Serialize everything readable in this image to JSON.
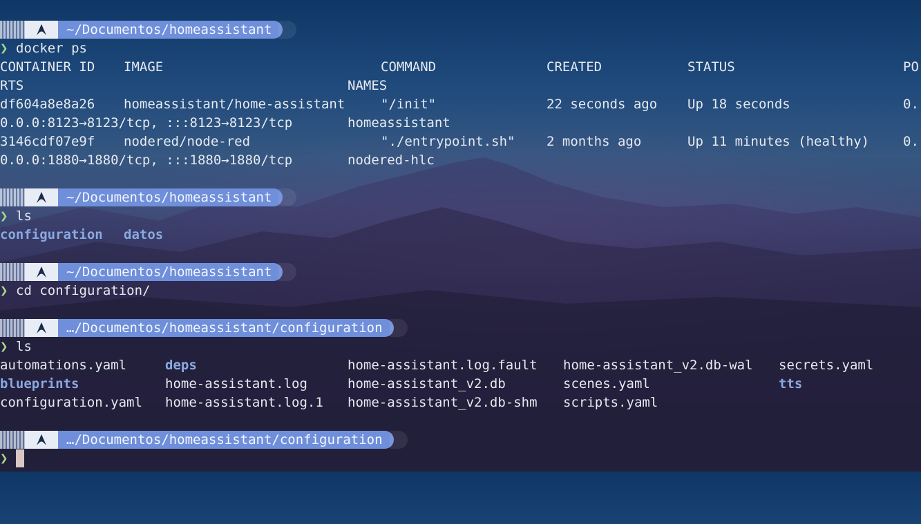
{
  "prompt_symbol": "❯",
  "os_icon": "arch-linux-icon",
  "prompts": [
    {
      "path": "~/Documentos/homeassistant",
      "command": "docker ps"
    },
    {
      "path": "~/Documentos/homeassistant",
      "command": "ls"
    },
    {
      "path": "~/Documentos/homeassistant",
      "command": "cd configuration/"
    },
    {
      "path": "…/Documentos/homeassistant/configuration",
      "command": "ls"
    },
    {
      "path": "…/Documentos/homeassistant/configuration",
      "command": ""
    }
  ],
  "docker_ps": {
    "headers": {
      "container_id": "CONTAINER ID",
      "image": "IMAGE",
      "command": "COMMAND",
      "created": "CREATED",
      "status": "STATUS",
      "ports_head": "PO",
      "ports_tail": "RTS",
      "names": "NAMES"
    },
    "rows": [
      {
        "container_id": "df604a8e8a26",
        "image": "homeassistant/home-assistant",
        "command": "\"/init\"",
        "created": "22 seconds ago",
        "status": "Up 18 seconds",
        "ports_head": "0.",
        "ports_tail": "0.0.0:8123→8123/tcp, :::8123→8123/tcp",
        "names": "homeassistant"
      },
      {
        "container_id": "3146cdf07e9f",
        "image": "nodered/node-red",
        "command": "\"./entrypoint.sh\"",
        "created": "2 months ago",
        "status": "Up 11 minutes (healthy)",
        "ports_head": "0.",
        "ports_tail": "0.0.0:1880→1880/tcp, :::1880→1880/tcp",
        "names": "nodered-hlc"
      }
    ]
  },
  "ls1": [
    "configuration",
    "datos"
  ],
  "ls2": {
    "col1": [
      "automations.yaml",
      "blueprints",
      "configuration.yaml"
    ],
    "col2": [
      "deps",
      "home-assistant.log",
      "home-assistant.log.1"
    ],
    "col3": [
      "home-assistant.log.fault",
      "home-assistant_v2.db",
      "home-assistant_v2.db-shm"
    ],
    "col4": [
      "home-assistant_v2.db-wal",
      "scenes.yaml",
      "scripts.yaml"
    ],
    "col5": [
      "secrets.yaml",
      "tts"
    ]
  }
}
